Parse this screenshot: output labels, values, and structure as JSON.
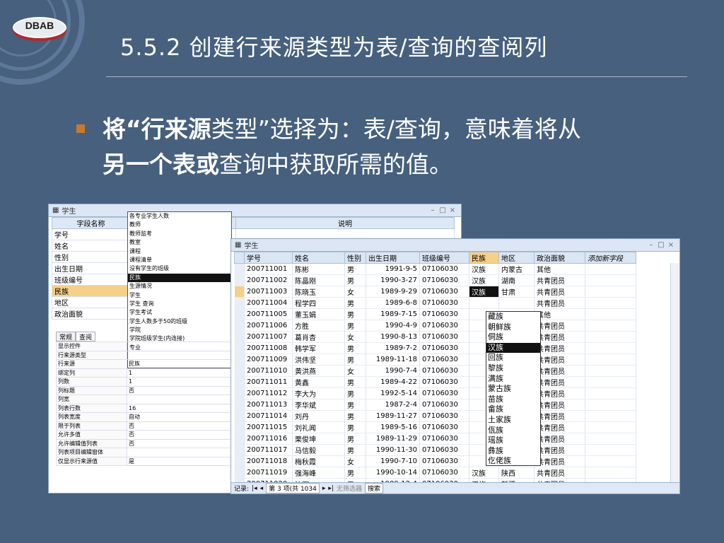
{
  "logo": {
    "text": "DBAB"
  },
  "slide": {
    "title": "5.5.2 创建行来源类型为表/查询的查阅列",
    "bullet_bold1": "将“行来源",
    "bullet_normal1": "类型”选择为：表/查询，意味着将从",
    "bullet_bold2": "另一个表或",
    "bullet_normal2": "查询中获取所需的值。"
  },
  "design_window": {
    "title": "学生",
    "col_field": "字段名称",
    "col_desc": "说明",
    "fields": [
      "学号",
      "姓名",
      "性别",
      "出生日期",
      "班级编号",
      "民族",
      "地区",
      "政治面貌"
    ],
    "query_list": [
      "各专业学生人数",
      "教师",
      "教师监考",
      "教室",
      "课程",
      "课程清单",
      "没有学生的班级",
      "民族",
      "生源情况",
      "学生",
      "学生 查询",
      "学生考试",
      "学生人数多于50的班级",
      "学院",
      "学院班级学生(内连接)",
      "专业"
    ],
    "query_selected": "民族",
    "tabs": [
      "常规",
      "查阅"
    ],
    "props": [
      [
        "显示控件",
        ""
      ],
      [
        "行来源类型",
        ""
      ],
      [
        "行来源",
        "民族"
      ],
      [
        "绑定列",
        "1"
      ],
      [
        "列数",
        "1"
      ],
      [
        "列标题",
        "否"
      ],
      [
        "列宽",
        ""
      ],
      [
        "列表行数",
        "16"
      ],
      [
        "列表宽度",
        "自动"
      ],
      [
        "限于列表",
        "否"
      ],
      [
        "允许多值",
        "否"
      ],
      [
        "允许编辑值列表",
        "否"
      ],
      [
        "列表项目编辑窗体",
        ""
      ],
      [
        "仅显示行来源值",
        "是"
      ]
    ]
  },
  "grid_window": {
    "title": "学生",
    "headers": [
      "学号",
      "姓名",
      "性别",
      "出生日期",
      "班级编号",
      "民族",
      "地区",
      "政治面貌",
      "添加新字段"
    ],
    "rows": [
      [
        "200711001",
        "陈彬",
        "男",
        "1991-9-5",
        "07106030",
        "汉族",
        "内蒙古",
        "其他"
      ],
      [
        "200711002",
        "陈晶刚",
        "男",
        "1990-3-27",
        "07106030",
        "汉族",
        "湖南",
        "共青团员"
      ],
      [
        "200711003",
        "陈晓玉",
        "女",
        "1989-9-29",
        "07106030",
        "汉族",
        "甘肃",
        "共青团员"
      ],
      [
        "200711004",
        "程学四",
        "男",
        "1989-6-8",
        "07106030",
        "",
        "",
        "共青团员"
      ],
      [
        "200711005",
        "董玉娟",
        "男",
        "1989-7-15",
        "07106030",
        "",
        "",
        "其他"
      ],
      [
        "200711006",
        "方胜",
        "男",
        "1990-4-9",
        "07106030",
        "",
        "",
        "共青团员"
      ],
      [
        "200711007",
        "葛肖杏",
        "女",
        "1990-8-13",
        "07106030",
        "",
        "",
        "共青团员"
      ],
      [
        "200711008",
        "韩学军",
        "男",
        "1989-7-2",
        "07106030",
        "",
        "",
        "共青团员"
      ],
      [
        "200711009",
        "洪伟坚",
        "男",
        "1989-11-18",
        "07106030",
        "",
        "",
        "共青团员"
      ],
      [
        "200711010",
        "黄洪燕",
        "女",
        "1990-7-4",
        "07106030",
        "",
        "",
        "共青团员"
      ],
      [
        "200711011",
        "黄鑫",
        "男",
        "1989-4-22",
        "07106030",
        "",
        "",
        "共青团员"
      ],
      [
        "200711012",
        "李大为",
        "男",
        "1992-5-14",
        "07106030",
        "",
        "",
        "共青团员"
      ],
      [
        "200711013",
        "李华斌",
        "男",
        "1987-2-4",
        "07106030",
        "",
        "",
        "共青团员"
      ],
      [
        "200711014",
        "刘丹",
        "男",
        "1989-11-27",
        "07106030",
        "",
        "",
        "共青团员"
      ],
      [
        "200711015",
        "刘礼闻",
        "男",
        "1989-5-16",
        "07106030",
        "",
        "",
        "共青团员"
      ],
      [
        "200711016",
        "栗俊坤",
        "男",
        "1989-11-29",
        "07106030",
        "",
        "",
        "共青团员"
      ],
      [
        "200711017",
        "马信毅",
        "男",
        "1990-11-30",
        "07106030",
        "",
        "",
        "共青团员"
      ],
      [
        "200711018",
        "梅秋霞",
        "女",
        "1990-7-10",
        "07106030",
        "",
        "",
        "共青团员"
      ],
      [
        "200711019",
        "强海峰",
        "男",
        "1990-10-14",
        "07106030",
        "汉族",
        "陕西",
        "共青团员"
      ],
      [
        "200711020",
        "沈辉",
        "男",
        "1989-12-4",
        "07106030",
        "汉族",
        "新疆",
        "共青团员"
      ]
    ],
    "nation_list": [
      "藏族",
      "朝鲜族",
      "侗族",
      "汉族",
      "回族",
      "黎族",
      "满族",
      "蒙古族",
      "苗族",
      "畲族",
      "土家族",
      "佤族",
      "瑶族",
      "彝族",
      "仡佬族",
      "壮族"
    ],
    "nation_selected": "汉族",
    "nav_record": "记录:",
    "nav_pos": "第 3 项(共 1034",
    "nav_filter": "无筛选器",
    "nav_search": "搜索"
  }
}
